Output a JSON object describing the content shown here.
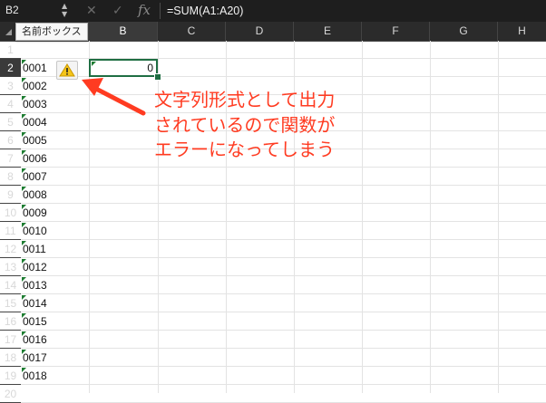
{
  "formula_bar": {
    "name_box": "B2",
    "cancel_icon": "x-icon",
    "enter_icon": "check-icon",
    "fx_label": "fx",
    "formula": "=SUM(A1:A20)"
  },
  "tooltip": "名前ボックス",
  "columns": [
    "B",
    "C",
    "D",
    "E",
    "F",
    "G",
    "H"
  ],
  "rows": [
    "1",
    "2",
    "3",
    "4",
    "5",
    "6",
    "7",
    "8",
    "9",
    "10",
    "11",
    "12",
    "13",
    "14",
    "15",
    "16",
    "17",
    "18",
    "19",
    "20"
  ],
  "column_a_values": [
    "",
    "0001",
    "0002",
    "0003",
    "0004",
    "0005",
    "0006",
    "0007",
    "0008",
    "0009",
    "0010",
    "0011",
    "0012",
    "0013",
    "0014",
    "0015",
    "0016",
    "0017",
    "0018",
    ""
  ],
  "selected_cell": {
    "ref": "B2",
    "value": "0"
  },
  "warning_icon": "warning-icon",
  "annotation": {
    "lines": [
      "文字列形式として出力",
      "されているので関数が",
      "エラーになってしまう"
    ],
    "color": "#ff3b21"
  },
  "colors": {
    "selection": "#1f6e43",
    "error_indicator": "#1e7d32",
    "header_bg": "#2b2b2b"
  }
}
